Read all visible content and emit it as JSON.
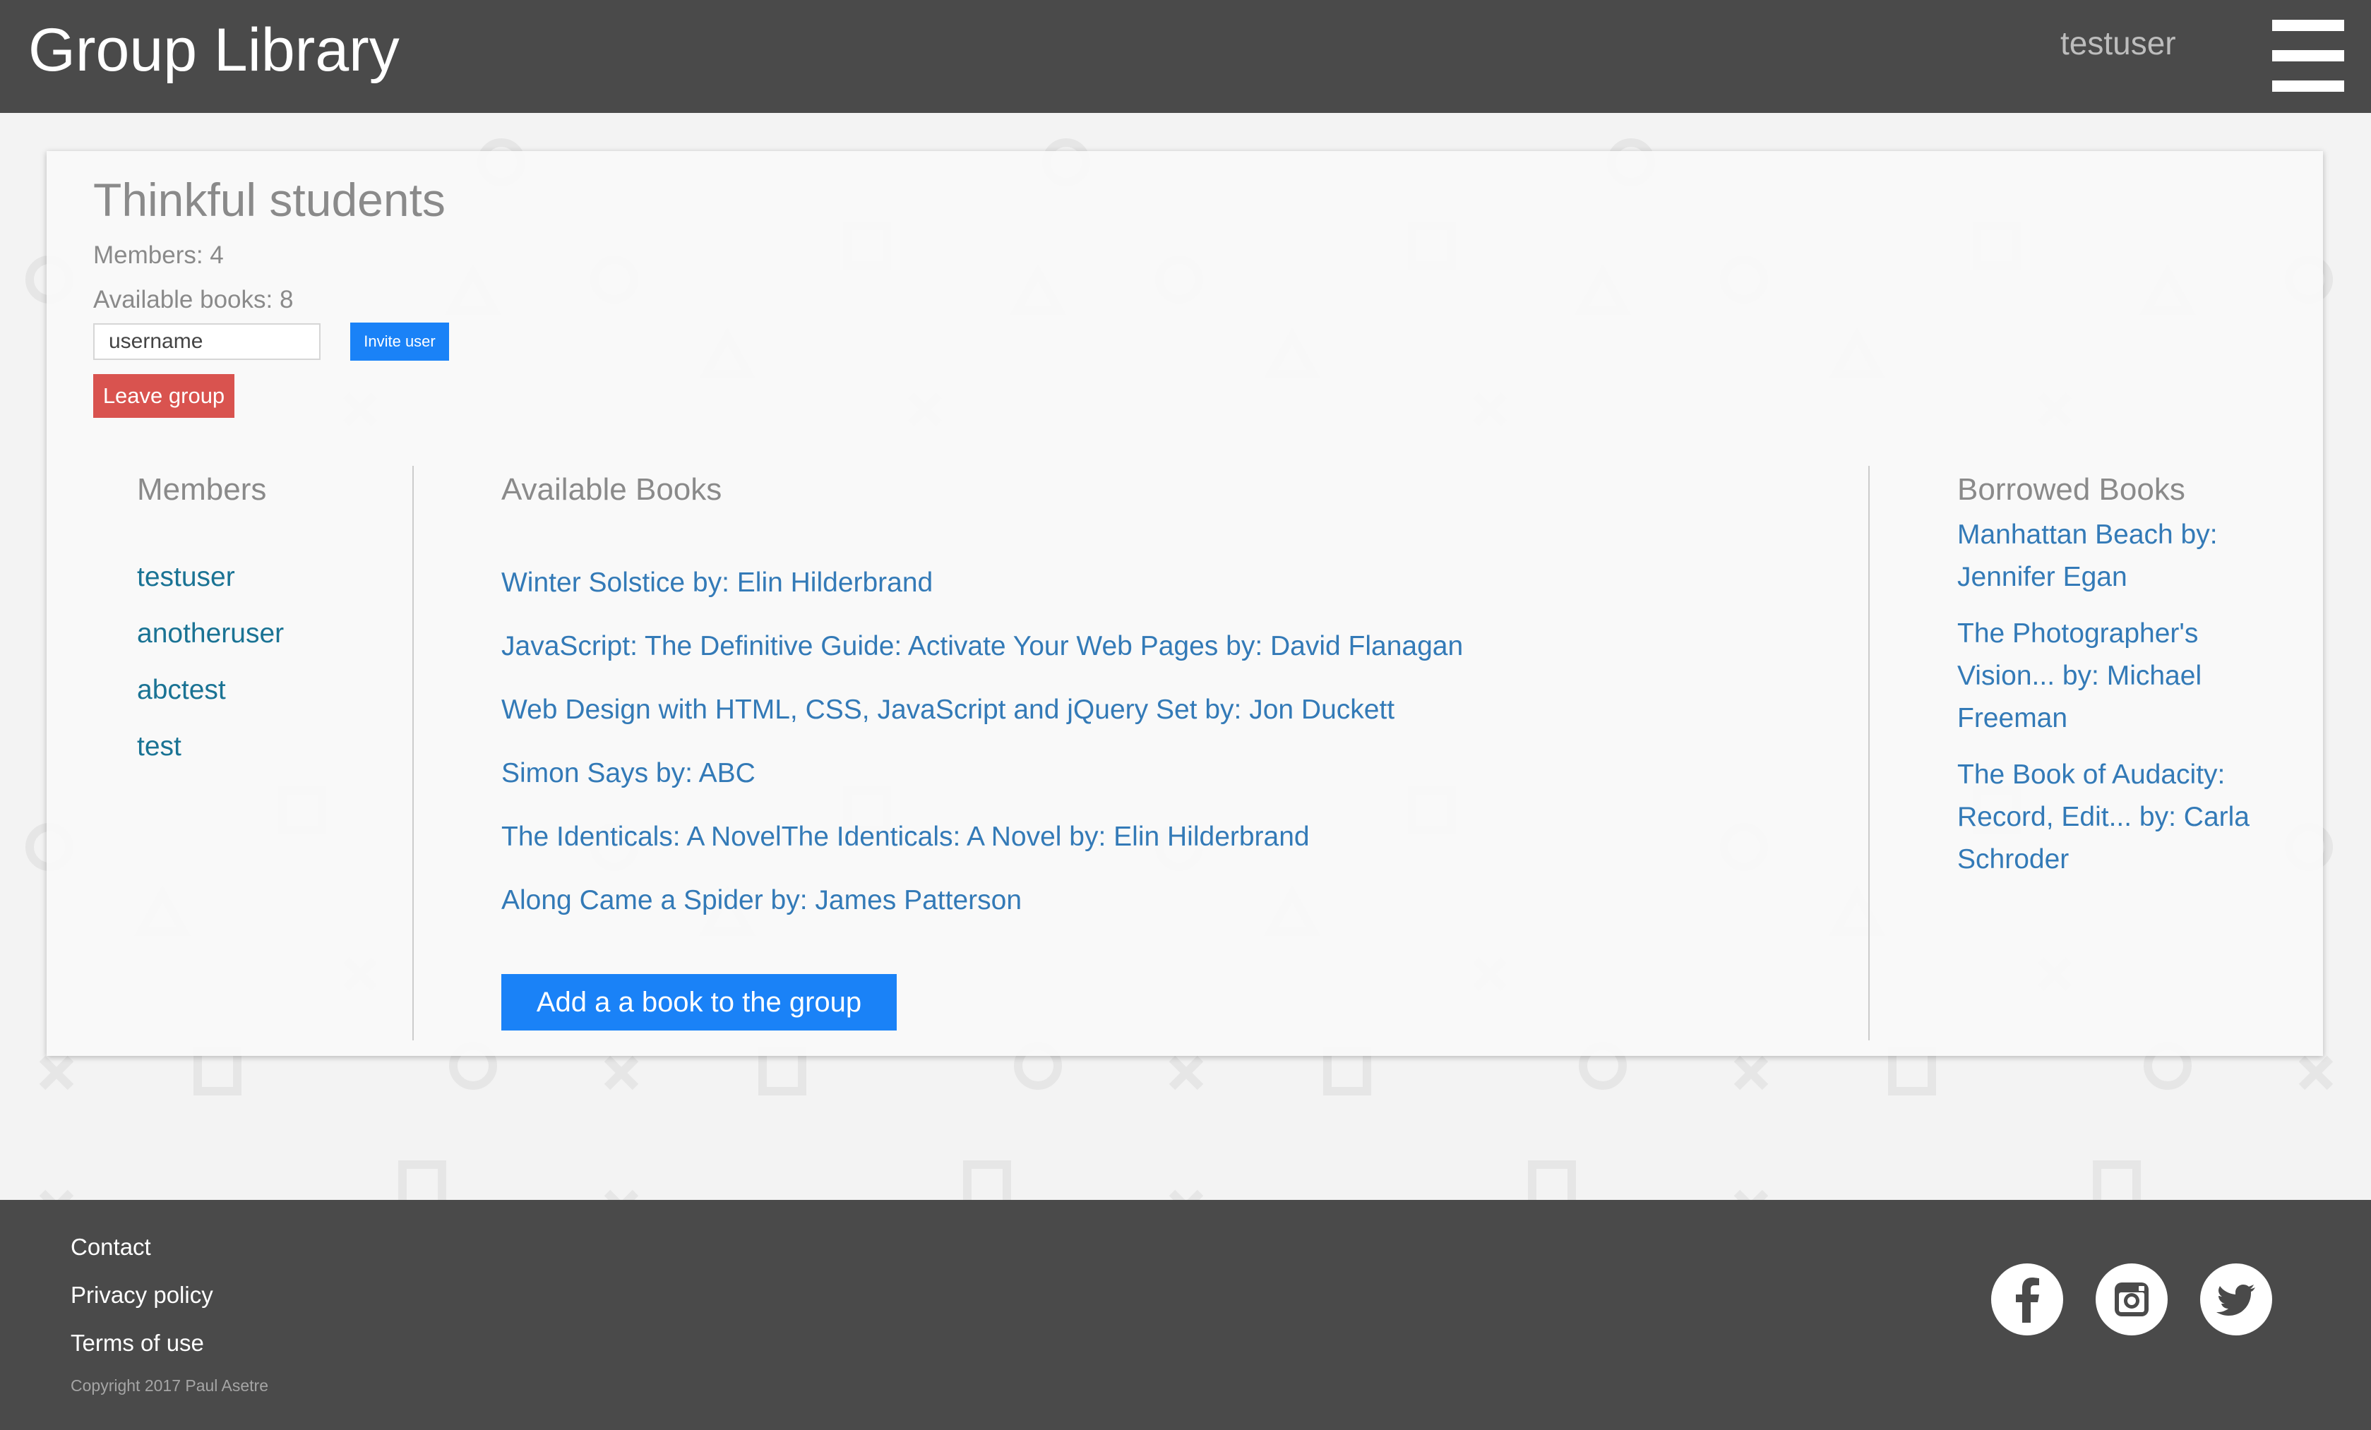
{
  "header": {
    "title": "Group Library",
    "username": "testuser",
    "menu_icon": "hamburger-menu-icon"
  },
  "group": {
    "name": "Thinkful students",
    "members_stat": "Members: 4",
    "books_stat": "Available books: 8",
    "invite_placeholder": "username",
    "invite_label": "Invite user",
    "leave_label": "Leave group"
  },
  "members": {
    "title": "Members",
    "items": [
      "testuser",
      "anotheruser",
      "abctest",
      "test"
    ]
  },
  "available_books": {
    "title": "Available Books",
    "items": [
      "Winter Solstice by: Elin Hilderbrand",
      "JavaScript: The Definitive Guide: Activate Your Web Pages by: David Flanagan",
      "Web Design with HTML, CSS, JavaScript and jQuery Set by: Jon Duckett",
      "Simon Says by: ABC",
      "The Identicals: A NovelThe Identicals: A Novel by: Elin Hilderbrand",
      "Along Came a Spider by: James Patterson"
    ],
    "add_label": "Add a a book to the group"
  },
  "borrowed_books": {
    "title": "Borrowed Books",
    "items": [
      "Manhattan Beach by: Jennifer Egan",
      "The Photographer's Vision... by: Michael Freeman",
      "The Book of Audacity: Record, Edit... by: Carla Schroder"
    ]
  },
  "footer": {
    "links": [
      "Contact",
      "Privacy policy",
      "Terms of use"
    ],
    "copyright": "Copyright 2017 Paul Asetre",
    "social_icons": [
      "facebook-icon",
      "instagram-icon",
      "twitter-icon"
    ]
  },
  "colors": {
    "header_bg": "#4a4a4a",
    "accent_blue": "#1a82f7",
    "link_blue": "#337ab7",
    "member_teal": "#1a7394",
    "leave_red": "#d9534f",
    "muted_text": "#8a8a8a"
  }
}
